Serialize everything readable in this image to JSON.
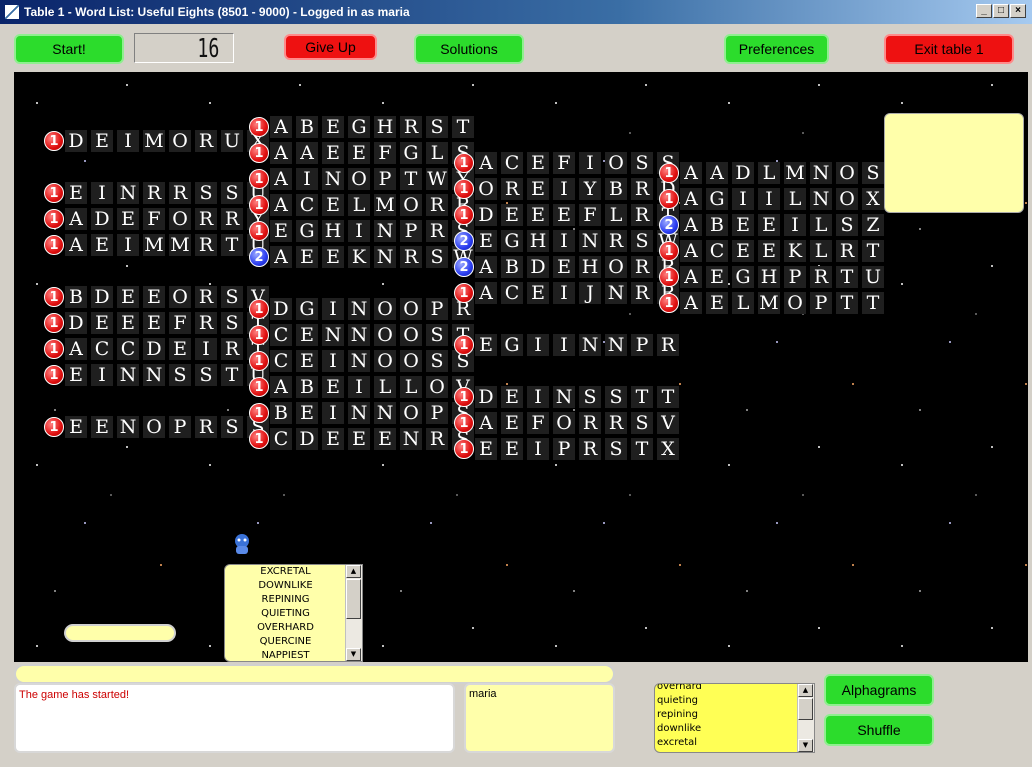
{
  "window": {
    "title": "Table 1 - Word List: Useful Eights (8501 - 9000) - Logged in as maria",
    "controls": [
      "_",
      "□",
      "×"
    ]
  },
  "toolbar": {
    "start_label": "Start!",
    "timer_value": "16",
    "give_up_label": "Give Up",
    "solutions_label": "Solutions",
    "preferences_label": "Preferences",
    "exit_label": "Exit table 1"
  },
  "columns": [
    [
      {
        "count": "1",
        "letters": "DEIMORUX"
      },
      null,
      {
        "count": "1",
        "letters": "EINRRSSU"
      },
      {
        "count": "1",
        "letters": "ADEFORRY"
      },
      {
        "count": "1",
        "letters": "AEIMMRTU"
      },
      null,
      {
        "count": "1",
        "letters": "BDEEORSV"
      },
      {
        "count": "1",
        "letters": "DEEEFRST"
      },
      {
        "count": "1",
        "letters": "ACCDEIRT"
      },
      {
        "count": "1",
        "letters": "EINNSSTU"
      },
      null,
      {
        "count": "1",
        "letters": "EENOPRSS"
      }
    ],
    [
      {
        "count": "1",
        "letters": "ABEGHRST"
      },
      {
        "count": "1",
        "letters": "AAEEFGLS"
      },
      {
        "count": "1",
        "letters": "AINOPTWY"
      },
      {
        "count": "1",
        "letters": "ACELMORR"
      },
      {
        "count": "1",
        "letters": "EGHINPRS"
      },
      {
        "count": "2",
        "letters": "AEEKNRSW"
      },
      null,
      {
        "count": "1",
        "letters": "DGINOOPR"
      },
      {
        "count": "1",
        "letters": "CENNOOST"
      },
      {
        "count": "1",
        "letters": "CEINOOSS"
      },
      {
        "count": "1",
        "letters": "ABEILLOV"
      },
      {
        "count": "1",
        "letters": "BEINNOPS"
      },
      {
        "count": "1",
        "letters": "CDEEENRS"
      }
    ],
    [
      {
        "count": "1",
        "letters": "ACEFIOSS"
      },
      {
        "count": "1",
        "letters": "OREIYBRD"
      },
      {
        "count": "1",
        "letters": "DEEEFLRT"
      },
      {
        "count": "2",
        "letters": "EGHINRSW"
      },
      {
        "count": "2",
        "letters": "ABDEHORR"
      },
      {
        "count": "1",
        "letters": "ACEIJNRR"
      },
      null,
      {
        "count": "1",
        "letters": "EGIINNPR"
      },
      null,
      {
        "count": "1",
        "letters": "DEINSSTT"
      },
      {
        "count": "1",
        "letters": "AEFORRSV"
      },
      {
        "count": "1",
        "letters": "EEIPRSTX"
      }
    ],
    [
      {
        "count": "1",
        "letters": "AADLMNOS"
      },
      {
        "count": "1",
        "letters": "AGIILNOX"
      },
      {
        "count": "2",
        "letters": "ABEEILSZ"
      },
      {
        "count": "1",
        "letters": "ACEEKLRT"
      },
      {
        "count": "1",
        "letters": "AEGHPRTU"
      },
      {
        "count": "1",
        "letters": "AELMOPTT"
      }
    ]
  ],
  "player_guesses": [
    "EXCRETAL",
    "DOWNLIKE",
    "REPINING",
    "QUIETING",
    "OVERHARD",
    "QUERCINE",
    "NAPPIEST"
  ],
  "my_guesses": [
    "overhard",
    "quieting",
    "repining",
    "downlike",
    "excretal"
  ],
  "chat": {
    "messages": [
      "The game has started!"
    ],
    "message_color": "#cc0000"
  },
  "users": [
    "maria"
  ],
  "buttons": {
    "alphagrams_label": "Alphagrams",
    "shuffle_label": "Shuffle"
  },
  "colors": {
    "start_green": "#2cdc2c",
    "give_up_red": "#ee1111",
    "badge_single": "#e01010",
    "badge_double": "#2b3df0",
    "list_yellow": "#ffffaa"
  }
}
